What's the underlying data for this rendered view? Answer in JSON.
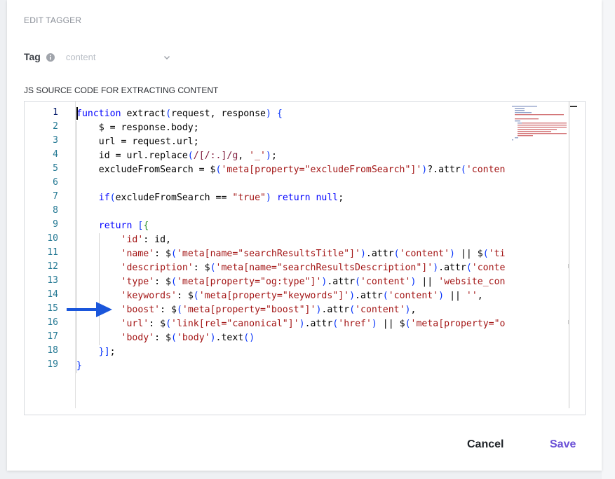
{
  "modal": {
    "title": "EDIT TAGGER",
    "tag_label": "Tag",
    "tag_value": "content",
    "code_section_label": "JS SOURCE CODE FOR EXTRACTING CONTENT"
  },
  "editor": {
    "line_numbers": [
      "1",
      "2",
      "3",
      "4",
      "5",
      "6",
      "7",
      "8",
      "9",
      "10",
      "11",
      "12",
      "13",
      "14",
      "15",
      "16",
      "17",
      "18",
      "19"
    ],
    "active_line": "1",
    "code_lines": [
      "function extract(request, response) {",
      "    $ = response.body;",
      "    url = request.url;",
      "    id = url.replace(/[/:.]/g, '_');",
      "    excludeFromSearch = $('meta[property=\"excludeFromSearch\"]')?.attr('content')",
      "",
      "    if(excludeFromSearch == \"true\") return null;",
      "",
      "    return [{",
      "        'id': id,",
      "        'name': $('meta[name=\"searchResultsTitle\"]').attr('content') || $('title",
      "        'description': $('meta[name=\"searchResultsDescription\"]').attr('content'",
      "        'type': $('meta[property=\"og:type\"]').attr('content') || 'website_conten",
      "        'keywords': $('meta[property=\"keywords\"]').attr('content') || '',",
      "        'boost': $('meta[property=\"boost\"]').attr('content'),",
      "        'url': $('link[rel=\"canonical\"]').attr('href') || $('meta[property=\"og:u",
      "        'body': $('body').text()",
      "    }];",
      "}"
    ]
  },
  "footer": {
    "cancel_label": "Cancel",
    "save_label": "Save"
  },
  "colors": {
    "accent": "#6a4fd6",
    "arrow": "#1a56db"
  },
  "icons": {
    "info": "info-icon",
    "dropdown": "chevron-down-icon",
    "pointer": "arrow-right-icon"
  }
}
